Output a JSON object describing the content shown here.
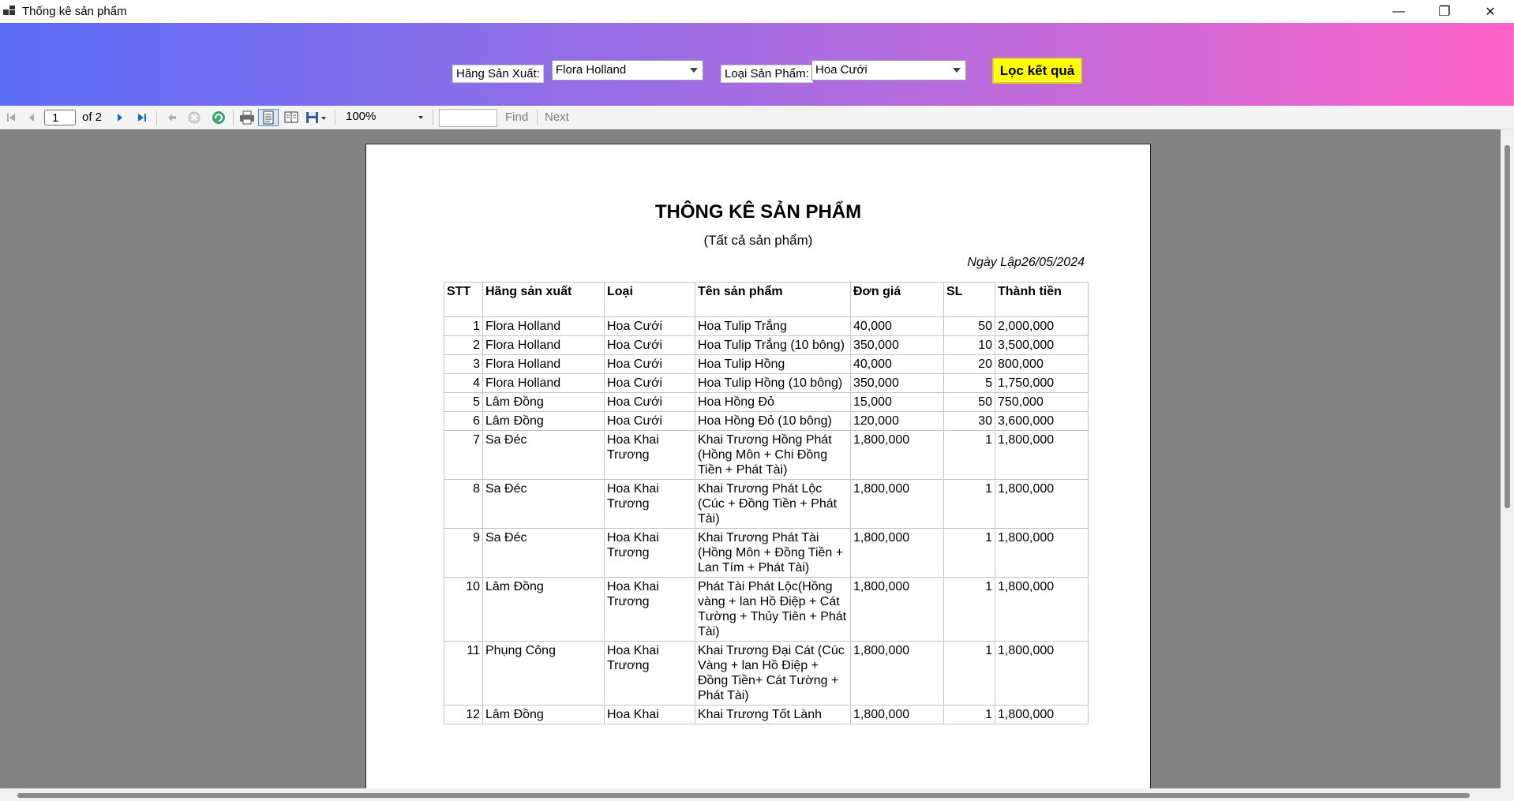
{
  "window": {
    "title": "Thống kê sản phẩm",
    "minimize_glyph": "—",
    "restore_glyph": "❐",
    "close_glyph": "✕"
  },
  "filter": {
    "manufacturer_label": "Hãng Sản Xuất:",
    "manufacturer_value": "Flora Holland",
    "category_label": "Loại Sản Phẩm:",
    "category_value": "Hoa Cưới",
    "button_label": "Lọc kết quả",
    "button_color": "#ffff00"
  },
  "toolbar": {
    "page_number": "1",
    "of_text": "of  2",
    "zoom": "100%",
    "find_text": "",
    "find_label": "Find",
    "next_label": "Next",
    "icons": [
      "first-page-icon",
      "prev-page-icon",
      "next-page-icon",
      "last-page-icon",
      "back-icon",
      "stop-icon",
      "refresh-icon",
      "print-icon",
      "print-layout-icon",
      "page-setup-icon",
      "export-icon"
    ]
  },
  "report": {
    "title": "THÔNG KÊ SẢN PHẨM",
    "subtitle": "(Tất cả sản phẩm)",
    "date_label": "Ngày Lập26/05/2024",
    "columns": [
      "STT",
      "Hãng sản xuất",
      "Loại",
      "Tên sản phẩm",
      "Đơn giá",
      "SL",
      "Thành tiền"
    ],
    "rows": [
      [
        "1",
        "Flora Holland",
        "Hoa Cưới",
        "Hoa Tulip Trắng",
        "40,000",
        "50",
        "2,000,000"
      ],
      [
        "2",
        "Flora Holland",
        "Hoa Cưới",
        "Hoa Tulip Trắng  (10 bông)",
        "350,000",
        "10",
        "3,500,000"
      ],
      [
        "3",
        "Flora Holland",
        "Hoa Cưới",
        "Hoa Tulip Hồng",
        "40,000",
        "20",
        "800,000"
      ],
      [
        "4",
        "Flora Holland",
        "Hoa Cưới",
        "Hoa Tulip Hồng (10 bông)",
        "350,000",
        "5",
        "1,750,000"
      ],
      [
        "5",
        "Lâm Đồng",
        "Hoa Cưới",
        "Hoa Hồng Đỏ",
        "15,000",
        "50",
        "750,000"
      ],
      [
        "6",
        "Lâm Đồng",
        "Hoa Cưới",
        "Hoa Hồng Đỏ (10 bông)",
        "120,000",
        "30",
        "3,600,000"
      ],
      [
        "7",
        "Sa Đéc",
        "Hoa Khai Trương",
        "Khai Trương Hồng Phát (Hồng Môn + Chi Đồng Tiền + Phát Tài)",
        "1,800,000",
        "1",
        "1,800,000"
      ],
      [
        "8",
        "Sa Đéc",
        "Hoa Khai Trương",
        "Khai Trương Phát Lộc (Cúc + Đồng Tiền + Phát Tài)",
        "1,800,000",
        "1",
        "1,800,000"
      ],
      [
        "9",
        "Sa Đéc",
        "Hoa Khai Trương",
        "Khai Trương Phát Tài (Hồng Môn + Đồng Tiền + Lan Tím  + Phát Tài)",
        "1,800,000",
        "1",
        "1,800,000"
      ],
      [
        "10",
        "Lâm Đồng",
        "Hoa Khai Trương",
        "Phát Tài Phát Lộc(Hồng vàng + lan Hồ Điệp + Cát Tường + Thủy Tiên + Phát Tài)",
        "1,800,000",
        "1",
        "1,800,000"
      ],
      [
        "11",
        "Phụng Công",
        "Hoa Khai Trương",
        "Khai Trương Đại Cát (Cúc Vàng + lan Hồ Điệp + Đồng Tiền+ Cát Tường + Phát Tài)",
        "1,800,000",
        "1",
        "1,800,000"
      ],
      [
        "12",
        "Lâm Đồng",
        "Hoa Khai",
        "Khai Trương Tốt Lành",
        "1,800,000",
        "1",
        "1,800,000"
      ]
    ]
  }
}
